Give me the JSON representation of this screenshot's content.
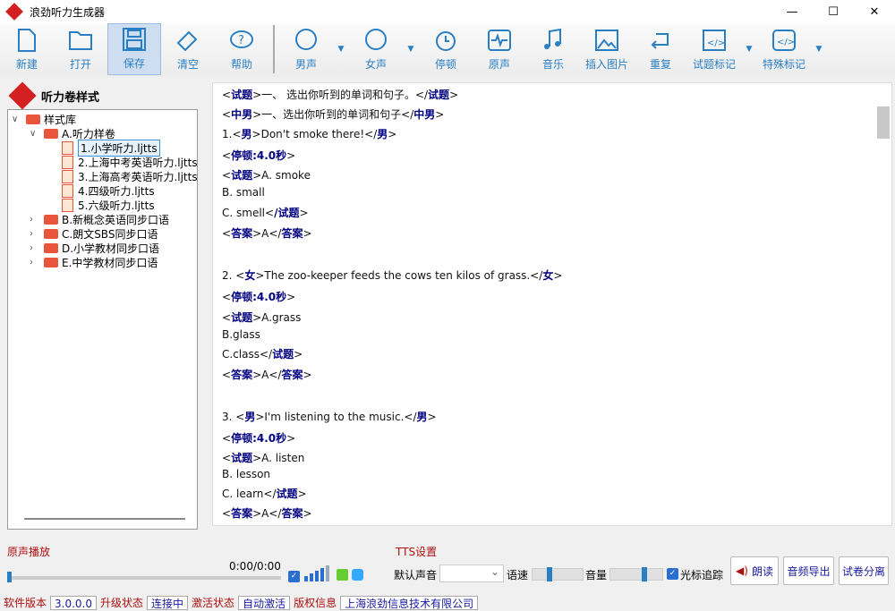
{
  "app": {
    "title": "浪劲听力生成器"
  },
  "toolbar": {
    "new": "新建",
    "open": "打开",
    "save": "保存",
    "clear": "清空",
    "help": "帮助",
    "male": "男声",
    "female": "女声",
    "pause": "停顿",
    "original": "原声",
    "music": "音乐",
    "insert_image": "插入图片",
    "repeat": "重复",
    "question_mark": "试题标记",
    "special_mark": "特殊标记"
  },
  "left": {
    "title": "听力卷样式",
    "tree": {
      "root": "样式库",
      "a": "A.听力样卷",
      "files": [
        "1.小学听力.ljtts",
        "2.上海中考英语听力.ljtts",
        "3.上海高考英语听力.ljtts",
        "4.四级听力.ljtts",
        "5.六级听力.ljtts"
      ],
      "others": [
        "B.新概念英语同步口语",
        "C.朗文SBS同步口语",
        "D.小学教材同步口语",
        "E.中学教材同步口语"
      ]
    }
  },
  "editor": {
    "lines": [
      [
        [
          "<",
          "试题",
          ">一、 选出你听到的单词和句子。</",
          "试题",
          ">"
        ]
      ],
      [
        [
          "<",
          "中男",
          ">一、选出你听到的单词和句子</",
          "中男",
          ">"
        ]
      ],
      [
        [
          "1.<",
          "男",
          ">Don't smoke there!</",
          "男",
          ">"
        ]
      ],
      [
        [
          "<",
          "停顿:4.0秒",
          ">",
          "",
          ""
        ]
      ],
      [
        [
          "<",
          "试题",
          ">A. smoke",
          "",
          ""
        ]
      ],
      [
        [
          "B. small",
          "",
          "",
          "",
          ""
        ]
      ],
      [
        [
          "C. smell<",
          "/试题",
          ">",
          "",
          ""
        ]
      ],
      [
        [
          "<",
          "答案",
          ">A</",
          "答案",
          ">"
        ]
      ],
      [
        [
          "2. <",
          "女",
          ">The zoo-keeper feeds the cows ten kilos of grass.</",
          "女",
          ">"
        ]
      ],
      [
        [
          "<",
          "停顿:4.0秒",
          ">",
          "",
          ""
        ]
      ],
      [
        [
          "<",
          "试题",
          ">A.grass",
          "",
          ""
        ]
      ],
      [
        [
          "B.glass",
          "",
          "",
          "",
          ""
        ]
      ],
      [
        [
          "C.class</",
          "试题",
          ">",
          "",
          ""
        ]
      ],
      [
        [
          "<",
          "答案",
          ">A</",
          "答案",
          ">"
        ]
      ],
      [
        [
          "3. <",
          "男",
          ">I'm listening to the music.</",
          "男",
          ">"
        ]
      ],
      [
        [
          "<",
          "停顿:4.0秒",
          ">",
          "",
          ""
        ]
      ],
      [
        [
          "<",
          "试题",
          ">A. listen",
          "",
          ""
        ]
      ],
      [
        [
          "B. lesson",
          "",
          "",
          "",
          ""
        ]
      ],
      [
        [
          "C. learn</",
          "试题",
          ">",
          "",
          ""
        ]
      ],
      [
        [
          "<",
          "答案",
          ">A</",
          "答案",
          ">"
        ]
      ]
    ]
  },
  "player": {
    "label": "原声播放",
    "time": "0:00/0:00",
    "progress": 0
  },
  "tts": {
    "label": "TTS设置",
    "default_voice": "默认声音",
    "voice_value": "",
    "speed": "语速",
    "speed_value": 0.3,
    "volume": "音量",
    "volume_value": 0.65,
    "cursor_track": "光标追踪",
    "read": "朗读",
    "export": "音频导出",
    "split": "试卷分离"
  },
  "status": {
    "version_label": "软件版本",
    "version": "3.0.0.0",
    "upgrade_label": "升级状态",
    "upgrade": "连接中",
    "activate_label": "激活状态",
    "activate": "自动激活",
    "copyright_label": "版权信息",
    "copyright": "上海浪劲信息技术有限公司"
  }
}
